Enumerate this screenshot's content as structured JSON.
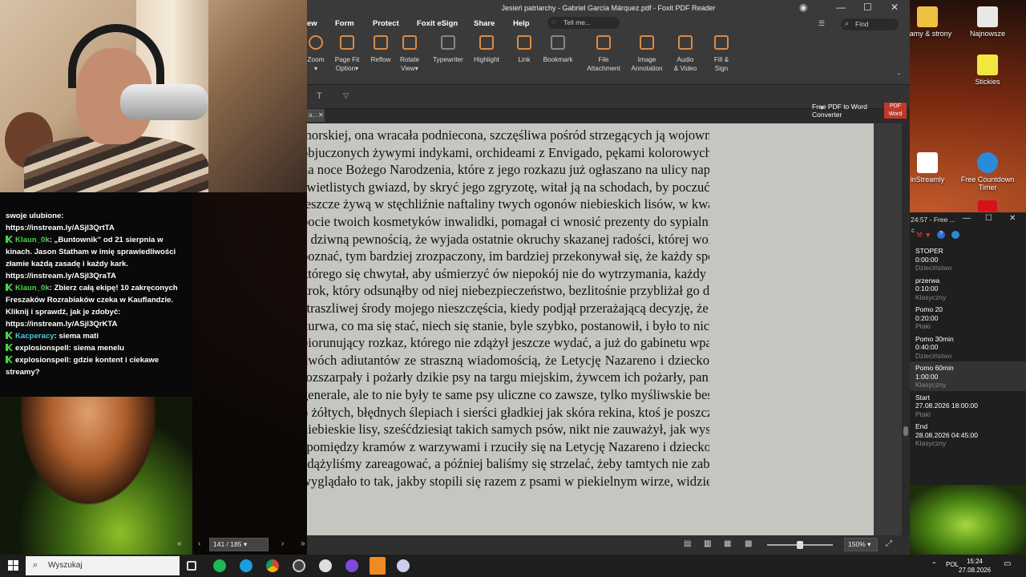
{
  "desktop": {
    "icons": [
      {
        "label": "gramy & strony"
      },
      {
        "label": "Najnowsze"
      },
      {
        "label": "Stickies"
      },
      {
        "label": "inStreamly"
      },
      {
        "label": "Free Countdown Timer"
      }
    ]
  },
  "chat": {
    "messages": [
      {
        "user": "",
        "text": "swoje ulubione:"
      },
      {
        "user": "",
        "text": "https://instream.ly/ASjl3QrtTA"
      },
      {
        "user": "Klaun_0k",
        "text": "„Buntownik” od 21 sierpnia w kinach. Jason Statham w imię sprawiedliwości złamie każdą zasadę i każdy kark. https://instream.ly/ASjl3QraTA"
      },
      {
        "user": "Klaun_0k",
        "text": "Zbierz całą ekipę! 10 zakręconych Freszaków Rozrabiaków czeka w Kauflandzie. Kliknij i sprawdź, jak je zdobyć: https://instream.ly/ASjl3QrKTA"
      },
      {
        "user": "Kacperacy",
        "text": "siema mati"
      },
      {
        "user": "explosionspell",
        "text": "siema menelu"
      },
      {
        "user": "explosionspell",
        "text": "gdzie kontent i ciekawe streamy?"
      }
    ]
  },
  "foxit": {
    "title": "Jesień patriarchy - Gabriel García Márquez.pdf - Foxit PDF Reader",
    "menu": [
      "ew",
      "Form",
      "Protect",
      "Foxit eSign",
      "Share",
      "Help"
    ],
    "tell_me": "Tell me...",
    "find": "Find",
    "ribbon": [
      {
        "label": "Zoom",
        "sub": ""
      },
      {
        "label": "Page Fit",
        "sub": "Option"
      },
      {
        "label": "Reflow",
        "sub": ""
      },
      {
        "label": "Rotate",
        "sub": "View"
      },
      {
        "label": "Typewriter",
        "sub": ""
      },
      {
        "label": "Highlight",
        "sub": ""
      },
      {
        "label": "Link",
        "sub": ""
      },
      {
        "label": "Bookmark",
        "sub": ""
      },
      {
        "label": "File",
        "sub": "Attachment"
      },
      {
        "label": "Image",
        "sub": "Annotation"
      },
      {
        "label": "Audio",
        "sub": "& Video"
      },
      {
        "label": "Fill &",
        "sub": "Sign"
      }
    ],
    "tab_label": "a...",
    "converter": "Free PDF to Word Converter",
    "converter_badge": "PDF Word",
    "page_lines": [
      "morskiej, ona wracała podniecona, szczęśliwa pośród strzegących ją wojowników",
      "objuczonych żywymi indykami, orchideami z Envigado, pękami kolorowych lampek",
      "na noce Bożego Narodzenia, które z jego rozkazu już ogłaszano na ulicy napisami",
      "świetlistych gwiazd, by skryć jego zgryzotę, witał ją na schodach, by poczuć cię",
      "jeszcze żywą w stęchliźnie naftaliny twych ogonów niebieskich lisów, w kwaśnym",
      "pocie twoich kosmetyków inwalidki, pomagał ci wnosić prezenty do sypialni",
      "z dziwną pewnością, że wyjada ostatnie okruchy skazanej radości, której wolałby nie",
      "poznać, tym bardziej zrozpaczony, im bardziej przekonywał się, że każdy sposób,",
      "którego się chwytał, aby uśmierzyć ów niepokój nie do wytrzymania, każdy jego",
      "krok, który odsunąłby od niej niebezpieczeństwo, bezlitośnie przybliżał go do",
      "straszliwej środy mojego nieszczęścia, kiedy podjął przerażającą decyzję, że dosyć,",
      "kurwa, co ma się stać, niech się stanie, byle szybko, postanowił, i było to niczym",
      "piorunujący rozkaz, którego nie zdążył jeszcze wydać, a już do gabinetu wpadło",
      "dwóch adiutantów ze straszną wiadomością, że Letycję Nazareno i dziecko",
      "rozszarpały i pożarły dzikie psy na targu miejskim, żywcem ich pożarły, panie",
      "generale, ale to nie były te same psy uliczne co zawsze, tylko myśliwskie bestie",
      "o żółtych, błędnych ślepiach i sierści gładkiej jak skóra rekina, ktoś je poszczuł na",
      "niebieskie lisy, sześćdziesiąt takich samych psów, nikt nie zauważył, jak wyskoczyły",
      "spomiędzy kramów z warzywami i rzuciły się na Letycję Nazareno i dziecko, nim",
      "zdążyliśmy zareagować, a później baliśmy się strzelać, żeby tamtych nie zabić, bo",
      "wyglądało to tak, jakby stopili się razem z psami w piekielnym wirze, widzieliśmy"
    ],
    "page_indicator": "141 / 185",
    "zoom": "150%",
    "zoom_level": 0.5
  },
  "timer": {
    "title": "24:57 - Free ...",
    "items": [
      {
        "name": "STOPER",
        "time": "0:00:00",
        "category": "Dzieciństwo"
      },
      {
        "name": "przerwa",
        "time": "0:10:00",
        "category": "Klasyczny"
      },
      {
        "name": "Pomo 20",
        "time": "0:20:00",
        "category": "Ptaki"
      },
      {
        "name": "Pomo 30min",
        "time": "0:40:00",
        "category": "Dzieciństwo"
      },
      {
        "name": "Pomo 60min",
        "time": "1:00:00",
        "category": "Klasyczny"
      },
      {
        "name": "Start",
        "time": "27.08.2026 18:00:00",
        "category": "Ptaki"
      },
      {
        "name": "End",
        "time": "28.08.2026 04:45:00",
        "category": "Klasyczny"
      }
    ]
  },
  "taskbar": {
    "search_placeholder": "Wyszukaj",
    "lang": "POL",
    "time": "15:24",
    "date": "27.08.2026"
  }
}
